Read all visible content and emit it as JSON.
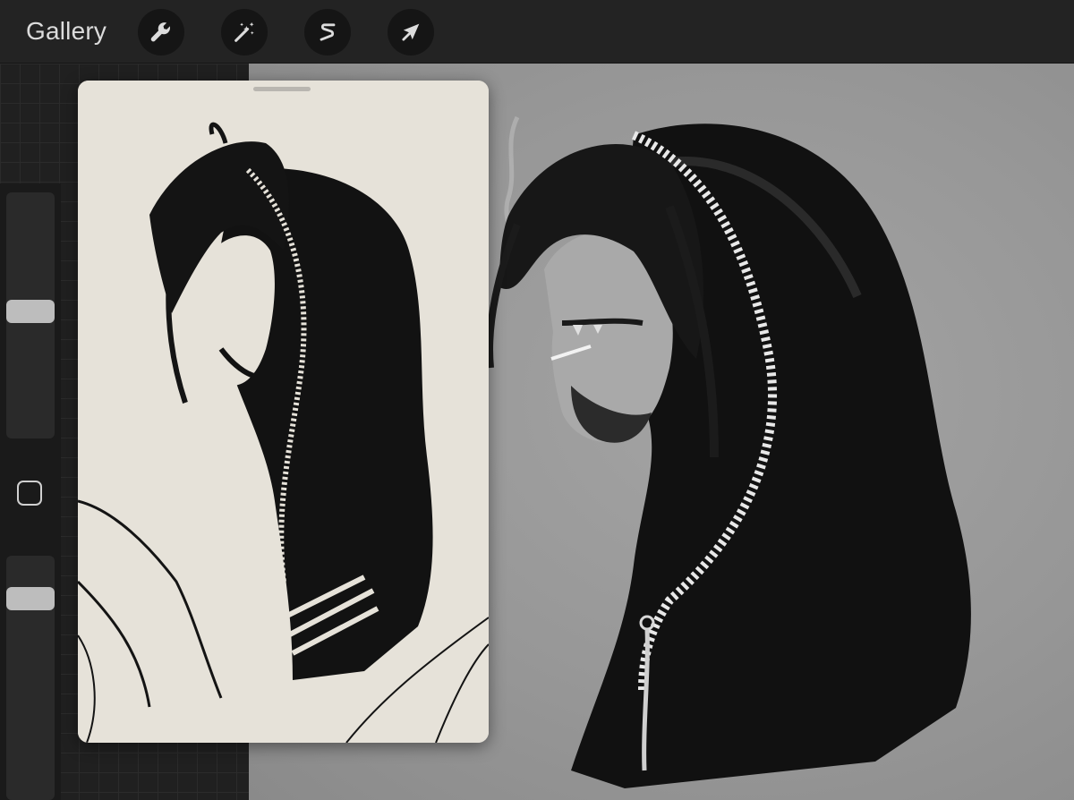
{
  "toolbar": {
    "gallery_label": "Gallery",
    "tools": [
      {
        "name": "actions",
        "icon": "wrench-icon"
      },
      {
        "name": "adjustments",
        "icon": "magic-wand-icon"
      },
      {
        "name": "selection",
        "icon": "selection-s-icon"
      },
      {
        "name": "transform",
        "icon": "arrow-cursor-icon"
      }
    ]
  },
  "sidebar": {
    "brush_size_level": 0.52,
    "opacity_level": 0.86
  },
  "colors": {
    "toolbar": "#232323",
    "canvas": "#979797",
    "reference_paper": "#e9e5dd",
    "ink": "#111111"
  }
}
